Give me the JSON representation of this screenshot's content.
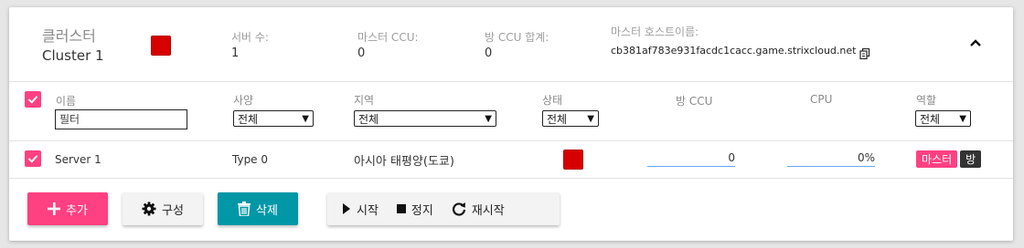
{
  "cluster": {
    "label": "클러스터",
    "name": "Cluster 1",
    "color": "#d60000"
  },
  "stats": {
    "servers": {
      "label": "서버 수:",
      "value": "1"
    },
    "master_ccu": {
      "label": "마스터 CCU:",
      "value": "0"
    },
    "room_ccu_total": {
      "label": "방 CCU 합계:",
      "value": "0"
    },
    "master_host": {
      "label": "마스터 호스트이름:",
      "value": "cb381af783e931facdc1cacc.game.strixcloud.net"
    }
  },
  "table": {
    "headers": {
      "name": "이름",
      "spec": "사양",
      "region": "지역",
      "status": "상태",
      "room_ccu": "방 CCU",
      "cpu": "CPU",
      "role": "역할"
    },
    "filters": {
      "name_placeholder": "필터",
      "spec": "전체",
      "region": "전체",
      "status": "전체",
      "role": "전체"
    },
    "rows": [
      {
        "checked": true,
        "name": "Server 1",
        "spec": "Type 0",
        "region": "아시아 태평양(도쿄)",
        "status_color": "#d60000",
        "room_ccu": "0",
        "cpu": "0%",
        "roles": [
          "마스터",
          "방"
        ]
      }
    ]
  },
  "actions": {
    "add": "추가",
    "configure": "구성",
    "delete": "삭제",
    "start": "시작",
    "stop": "정지",
    "restart": "재시작"
  }
}
